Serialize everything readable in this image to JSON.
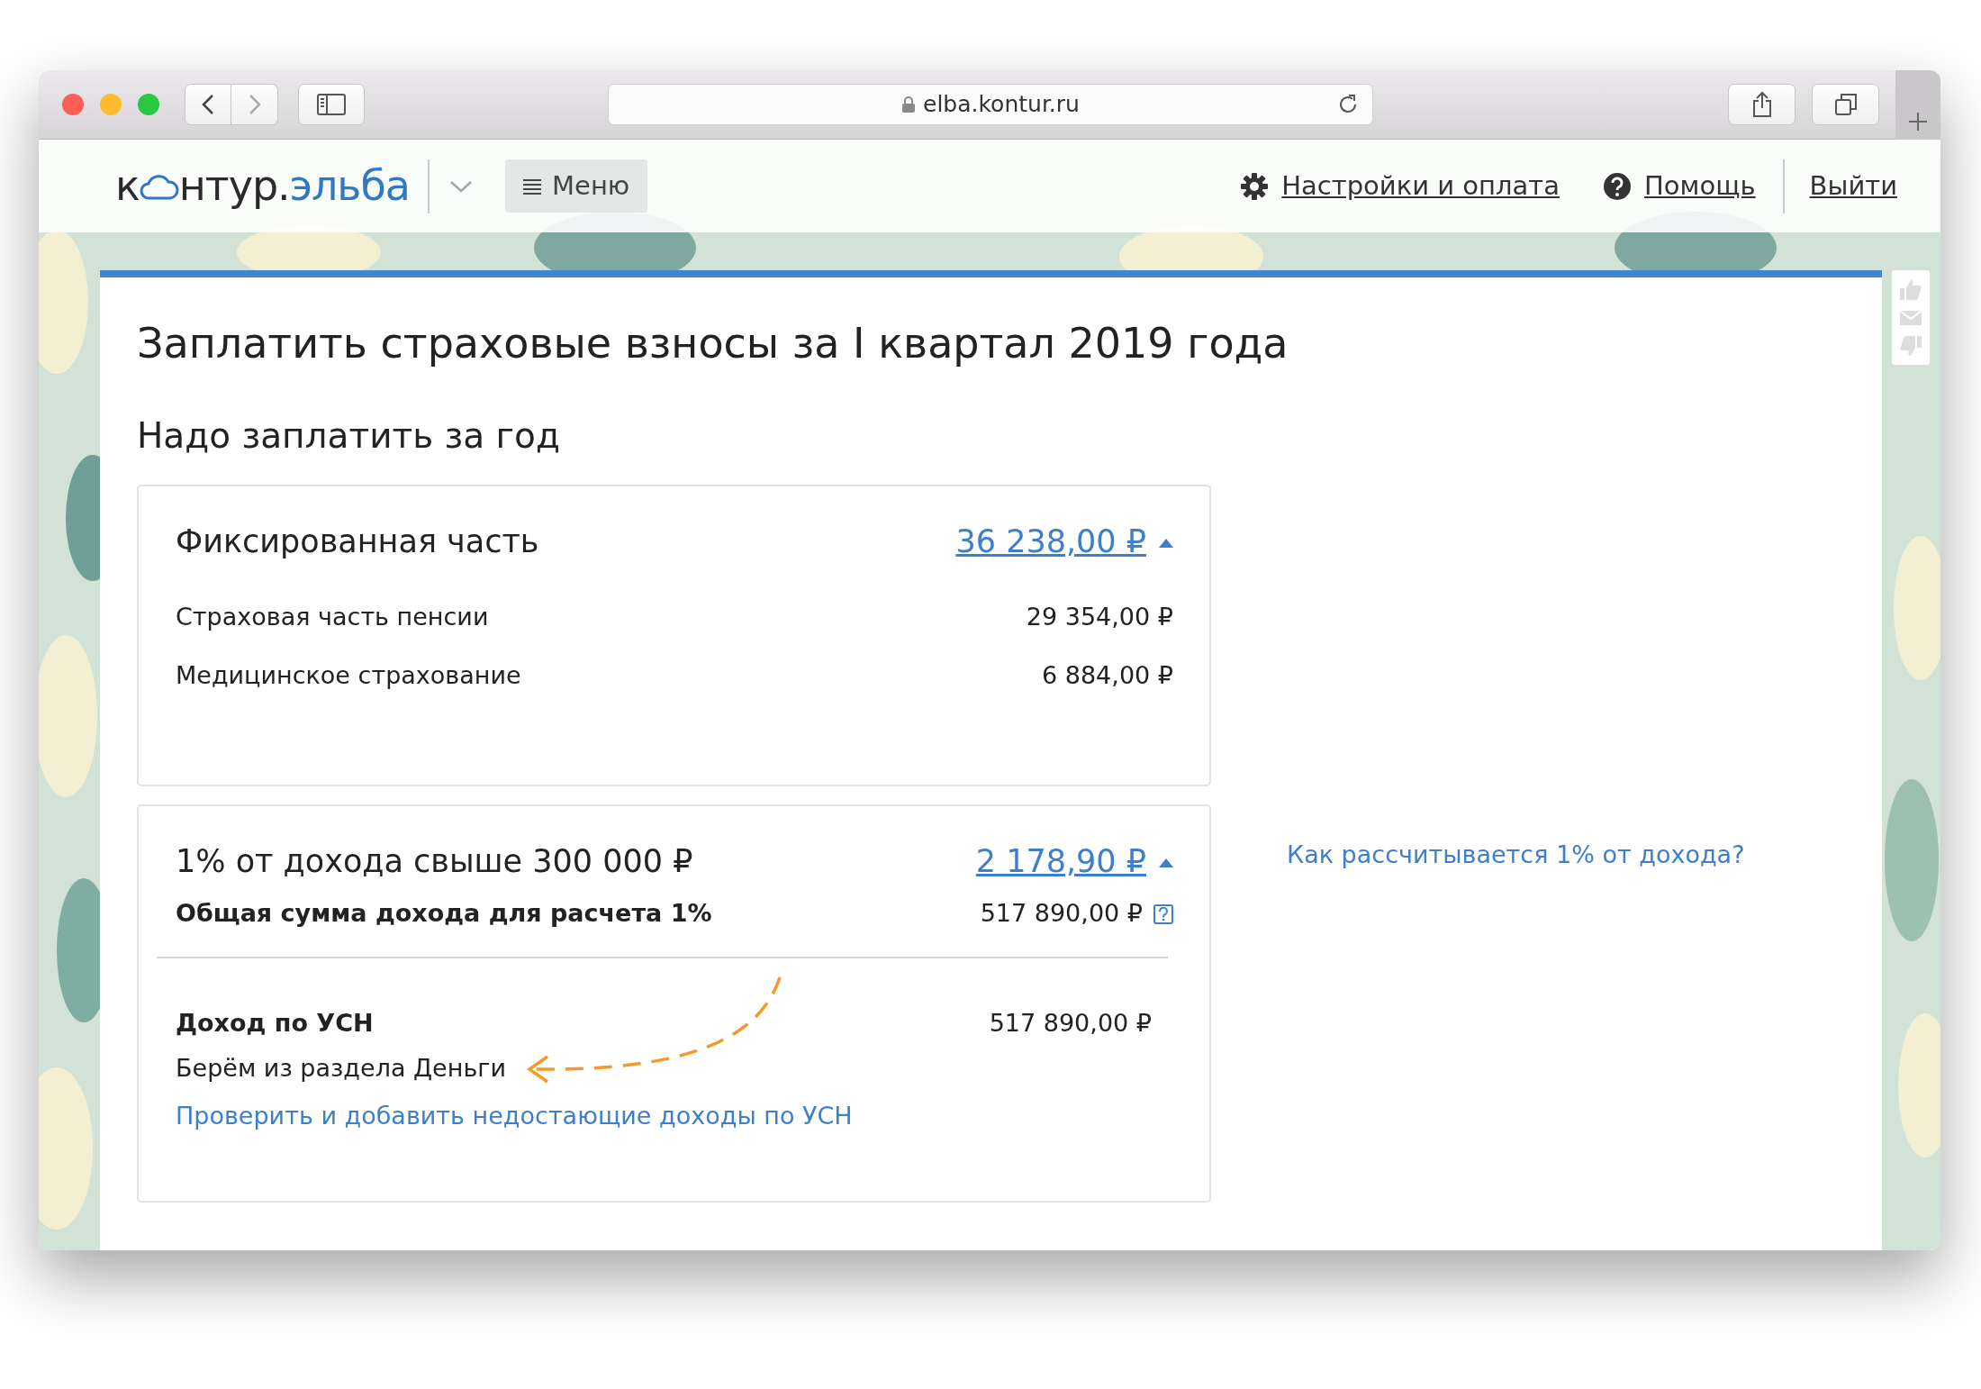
{
  "browser": {
    "address": "elba.kontur.ru"
  },
  "header": {
    "logo": {
      "start": "к",
      "end": "нтур.",
      "accent": "эльба"
    },
    "menu": "Меню",
    "settings": "Настройки и оплата",
    "help": "Помощь",
    "logout": "Выйти"
  },
  "title": "Заплатить страховые взносы за I квартал 2019 года",
  "subtitle": "Надо заплатить за год",
  "sections": [
    {
      "title": "Фиксированная часть",
      "amount": "36 238,00 ₽",
      "expanded": true,
      "rows": [
        {
          "kind": "plain",
          "label": "Страховая часть пенсии",
          "value": "29 354,00 ₽"
        },
        {
          "kind": "plain",
          "label": "Медицинское страхование",
          "value": "6 884,00 ₽"
        }
      ]
    },
    {
      "title": "1% от дохода свыше 300 000 ₽",
      "amount": "2 178,90 ₽",
      "expanded": true,
      "rows": [
        {
          "kind": "total",
          "label": "Общая сумма дохода для расчета 1%",
          "value": "517 890,00 ₽"
        }
      ],
      "detail": {
        "label": "Доход по УСН",
        "value": "517 890,00 ₽",
        "note": "Берём из раздела Деньги",
        "link": "Проверить и добавить недостающие доходы по УСН"
      }
    }
  ],
  "side_link": "Как рассчитывается 1% от дохода?"
}
